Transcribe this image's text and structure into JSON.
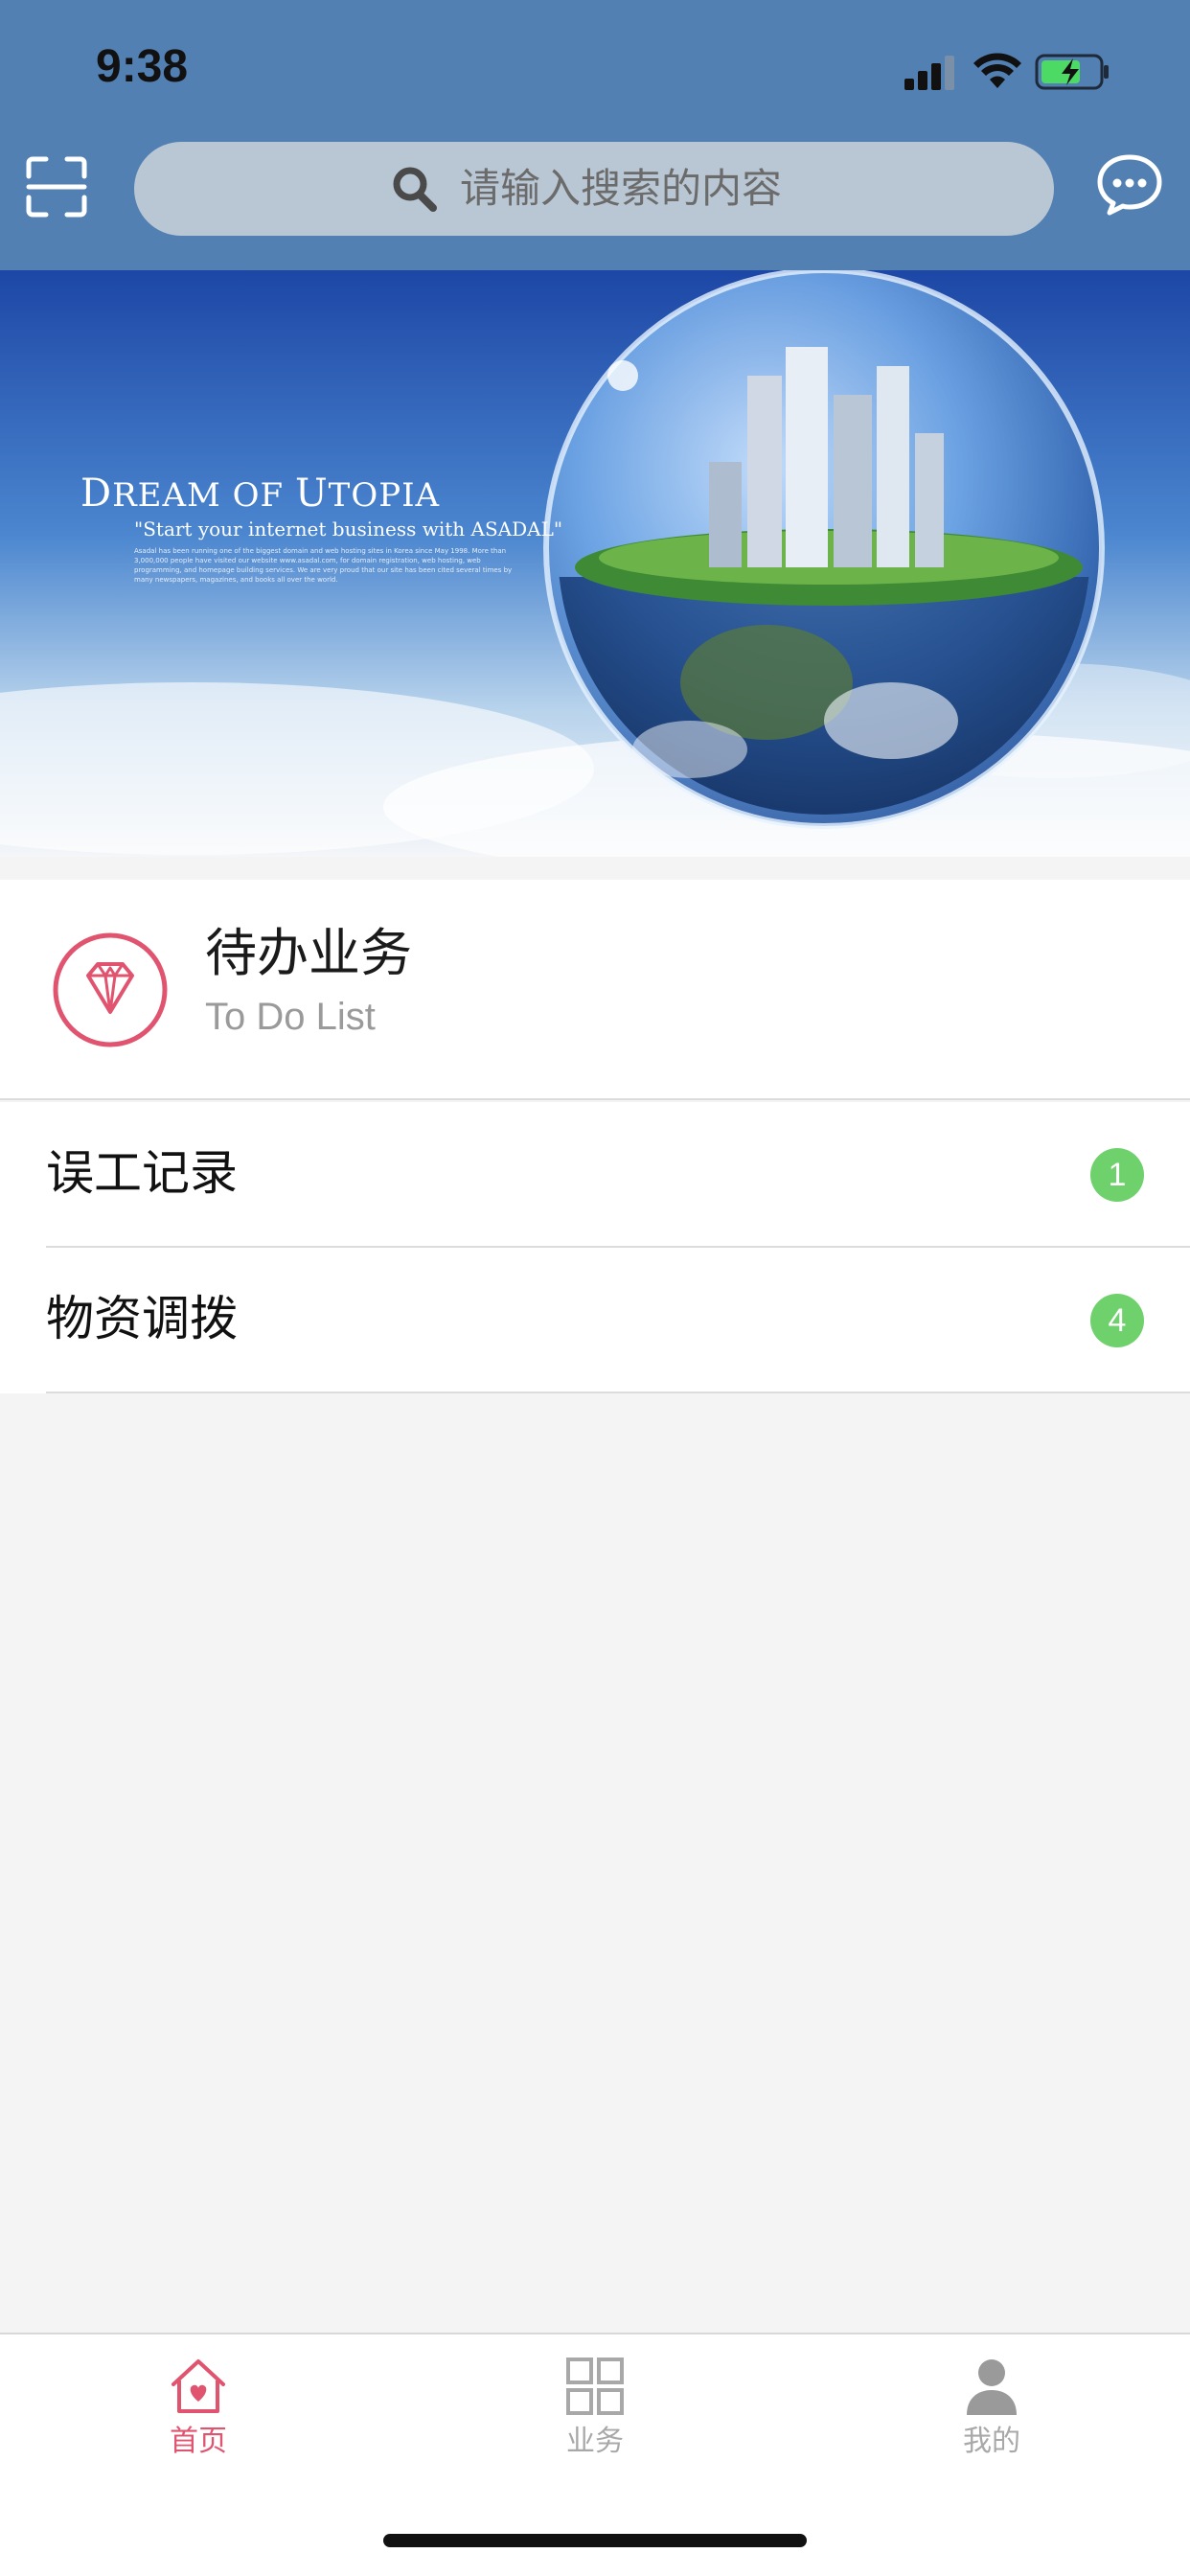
{
  "status_bar": {
    "time": "9:38",
    "icons": [
      "signal-icon",
      "wifi-icon",
      "battery-charging-icon"
    ]
  },
  "header": {
    "search_placeholder": "请输入搜索的内容",
    "left_icon": "scan-icon",
    "right_icon": "message-icon",
    "background_color": "#5280b3"
  },
  "banner": {
    "title_parts": [
      "D",
      "REAM OF ",
      "U",
      "TOPIA"
    ],
    "subtitle": "\"Start your internet business with ASADAL\"",
    "small_text": "Asadal has been running one of the biggest domain and web hosting sites in Korea since May 1998. More than 3,000,000 people have visited our website www.asadal.com, for domain registration, web hosting, web programming, and homepage building services. We are very proud that our site has been cited several times by many newspapers, magazines, and books all over the world."
  },
  "todo_card": {
    "icon": "diamond-icon",
    "title": "待办业务",
    "subtitle": "To Do List",
    "accent_color": "#e05470"
  },
  "todo_items": [
    {
      "label": "误工记录",
      "count": "1"
    },
    {
      "label": "物资调拨",
      "count": "4"
    }
  ],
  "tab_bar": {
    "tabs": [
      {
        "label": "首页",
        "icon": "home-heart-icon",
        "active": true
      },
      {
        "label": "业务",
        "icon": "grid-icon",
        "active": false
      },
      {
        "label": "我的",
        "icon": "user-icon",
        "active": false
      }
    ],
    "active_color": "#e05470",
    "inactive_color": "#a8a8a8"
  }
}
